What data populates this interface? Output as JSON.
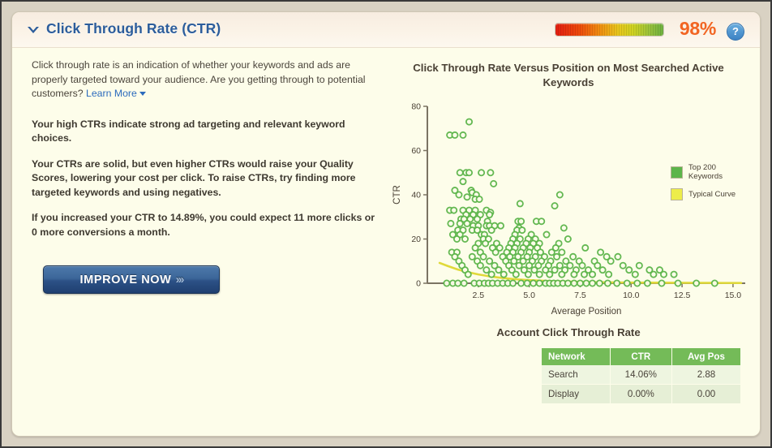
{
  "header": {
    "title": "Click Through Rate (CTR)",
    "collapse_icon": "chevron-down-icon",
    "score": "98%",
    "help_icon": "?",
    "gauge_colors": [
      "#e31d10",
      "#f08a10",
      "#e8c61c",
      "#6db13f"
    ],
    "score_color": "#f26522",
    "title_color": "#2c5d9b"
  },
  "left": {
    "intro": "Click through rate is an indication of whether your keywords and ads are properly targeted toward your audience. Are you getting through to potential customers? ",
    "learn_more": "Learn More",
    "verdict": "Your high CTRs indicate strong ad targeting and relevant keyword choices.",
    "advice": "Your CTRs are solid, but even higher CTRs would raise your Quality Scores, lowering your cost per click. To raise CTRs, try finding more targeted keywords and using negatives.",
    "projection": "If you increased your CTR to 14.89%, you could expect 11 more clicks or 0 more conversions a month.",
    "cta_label": "IMPROVE NOW",
    "cta_arrows": "›››"
  },
  "chart_data": {
    "type": "scatter",
    "title": "Click Through Rate Versus Position on Most Searched Active Keywords",
    "xlabel": "Average Position",
    "ylabel": "CTR",
    "xlim": [
      0,
      15.6
    ],
    "ylim": [
      0,
      80
    ],
    "xticks": [
      2.5,
      5.0,
      7.5,
      10.0,
      12.5,
      15.0
    ],
    "xtick_labels": [
      "2.5",
      "5.0",
      "7.5",
      "10.0",
      "12.5",
      "15.0"
    ],
    "yticks": [
      0,
      20,
      40,
      60,
      80
    ],
    "ytick_labels": [
      "0",
      "20",
      "40",
      "60",
      "80"
    ],
    "grid": false,
    "legend_position": "right",
    "series": [
      {
        "name": "Top 200 Keywords",
        "color": "#5cb54a",
        "marker": "open-circle",
        "points": [
          [
            1.1,
            67
          ],
          [
            1.35,
            67
          ],
          [
            1.75,
            67
          ],
          [
            2.05,
            73
          ],
          [
            1.6,
            50
          ],
          [
            1.9,
            50
          ],
          [
            2.05,
            50
          ],
          [
            2.65,
            50
          ],
          [
            3.1,
            50
          ],
          [
            1.75,
            46
          ],
          [
            3.25,
            45
          ],
          [
            1.35,
            42
          ],
          [
            2.15,
            42
          ],
          [
            2.2,
            41
          ],
          [
            1.55,
            40
          ],
          [
            2.4,
            40
          ],
          [
            6.5,
            40
          ],
          [
            1.95,
            39
          ],
          [
            2.35,
            38
          ],
          [
            2.55,
            38
          ],
          [
            4.55,
            36
          ],
          [
            6.25,
            35
          ],
          [
            1.1,
            33
          ],
          [
            1.3,
            33
          ],
          [
            1.75,
            33
          ],
          [
            2.05,
            33
          ],
          [
            2.35,
            33
          ],
          [
            2.9,
            33
          ],
          [
            3.1,
            32
          ],
          [
            1.9,
            31
          ],
          [
            2.25,
            31
          ],
          [
            2.6,
            31
          ],
          [
            3.05,
            31
          ],
          [
            1.65,
            29
          ],
          [
            1.8,
            29
          ],
          [
            2.1,
            29
          ],
          [
            2.45,
            29
          ],
          [
            2.95,
            28
          ],
          [
            4.45,
            28
          ],
          [
            4.6,
            28
          ],
          [
            5.35,
            28
          ],
          [
            5.6,
            28
          ],
          [
            1.15,
            27
          ],
          [
            1.6,
            27
          ],
          [
            1.95,
            27
          ],
          [
            2.25,
            26
          ],
          [
            2.5,
            26
          ],
          [
            2.9,
            26
          ],
          [
            3.05,
            26
          ],
          [
            3.3,
            26
          ],
          [
            3.6,
            26
          ],
          [
            4.5,
            25
          ],
          [
            6.7,
            25
          ],
          [
            1.5,
            24
          ],
          [
            1.75,
            24
          ],
          [
            2.2,
            24
          ],
          [
            2.45,
            24
          ],
          [
            3.15,
            24
          ],
          [
            4.4,
            24
          ],
          [
            4.65,
            24
          ],
          [
            1.25,
            22
          ],
          [
            1.6,
            22
          ],
          [
            2.65,
            22
          ],
          [
            2.8,
            22
          ],
          [
            4.3,
            22
          ],
          [
            5.1,
            22
          ],
          [
            5.85,
            22
          ],
          [
            1.45,
            20
          ],
          [
            1.85,
            20
          ],
          [
            2.75,
            20
          ],
          [
            3.0,
            20
          ],
          [
            4.2,
            20
          ],
          [
            4.55,
            20
          ],
          [
            4.95,
            20
          ],
          [
            5.3,
            20
          ],
          [
            6.9,
            20
          ],
          [
            2.5,
            18
          ],
          [
            2.85,
            18
          ],
          [
            3.4,
            18
          ],
          [
            4.1,
            18
          ],
          [
            4.4,
            18
          ],
          [
            4.85,
            18
          ],
          [
            5.2,
            18
          ],
          [
            5.5,
            18
          ],
          [
            6.45,
            18
          ],
          [
            2.35,
            16
          ],
          [
            3.2,
            16
          ],
          [
            3.55,
            16
          ],
          [
            4.0,
            16
          ],
          [
            4.3,
            16
          ],
          [
            4.7,
            16
          ],
          [
            5.05,
            16
          ],
          [
            5.4,
            16
          ],
          [
            6.3,
            16
          ],
          [
            7.75,
            16
          ],
          [
            1.2,
            14
          ],
          [
            1.45,
            14
          ],
          [
            2.6,
            14
          ],
          [
            3.35,
            14
          ],
          [
            3.9,
            14
          ],
          [
            4.2,
            14
          ],
          [
            4.6,
            14
          ],
          [
            5.0,
            14
          ],
          [
            5.55,
            14
          ],
          [
            6.1,
            14
          ],
          [
            6.6,
            14
          ],
          [
            8.5,
            14
          ],
          [
            1.35,
            12
          ],
          [
            2.2,
            12
          ],
          [
            2.75,
            12
          ],
          [
            3.7,
            12
          ],
          [
            4.05,
            12
          ],
          [
            4.45,
            12
          ],
          [
            4.9,
            12
          ],
          [
            5.3,
            12
          ],
          [
            5.75,
            12
          ],
          [
            6.35,
            12
          ],
          [
            7.15,
            12
          ],
          [
            8.8,
            12
          ],
          [
            9.35,
            12
          ],
          [
            1.55,
            10
          ],
          [
            2.45,
            10
          ],
          [
            3.05,
            10
          ],
          [
            3.85,
            10
          ],
          [
            4.25,
            10
          ],
          [
            4.7,
            10
          ],
          [
            5.15,
            10
          ],
          [
            5.6,
            10
          ],
          [
            6.05,
            10
          ],
          [
            6.8,
            10
          ],
          [
            7.45,
            10
          ],
          [
            8.2,
            10
          ],
          [
            9.0,
            10
          ],
          [
            1.7,
            8
          ],
          [
            2.6,
            8
          ],
          [
            3.3,
            8
          ],
          [
            4.0,
            8
          ],
          [
            4.5,
            8
          ],
          [
            5.0,
            8
          ],
          [
            5.45,
            8
          ],
          [
            5.95,
            8
          ],
          [
            6.5,
            8
          ],
          [
            7.0,
            8
          ],
          [
            7.6,
            8
          ],
          [
            8.35,
            8
          ],
          [
            9.6,
            8
          ],
          [
            10.4,
            8
          ],
          [
            1.85,
            6
          ],
          [
            2.9,
            6
          ],
          [
            3.5,
            6
          ],
          [
            4.15,
            6
          ],
          [
            4.75,
            6
          ],
          [
            5.25,
            6
          ],
          [
            5.8,
            6
          ],
          [
            6.25,
            6
          ],
          [
            6.75,
            6
          ],
          [
            7.3,
            6
          ],
          [
            7.9,
            6
          ],
          [
            8.6,
            6
          ],
          [
            9.9,
            6
          ],
          [
            10.9,
            6
          ],
          [
            11.4,
            6
          ],
          [
            2.0,
            4
          ],
          [
            3.15,
            4
          ],
          [
            3.75,
            4
          ],
          [
            4.35,
            4
          ],
          [
            4.95,
            4
          ],
          [
            5.5,
            4
          ],
          [
            6.0,
            4
          ],
          [
            6.6,
            4
          ],
          [
            7.2,
            4
          ],
          [
            7.7,
            4
          ],
          [
            8.1,
            4
          ],
          [
            8.9,
            4
          ],
          [
            10.2,
            4
          ],
          [
            11.1,
            4
          ],
          [
            11.6,
            4
          ],
          [
            12.1,
            4
          ],
          [
            0.95,
            0
          ],
          [
            1.25,
            0
          ],
          [
            1.5,
            0
          ],
          [
            1.8,
            0
          ],
          [
            2.3,
            0
          ],
          [
            2.55,
            0
          ],
          [
            2.8,
            0
          ],
          [
            3.0,
            0
          ],
          [
            3.2,
            0
          ],
          [
            3.45,
            0
          ],
          [
            3.7,
            0
          ],
          [
            3.95,
            0
          ],
          [
            4.2,
            0
          ],
          [
            4.6,
            0
          ],
          [
            4.9,
            0
          ],
          [
            5.2,
            0
          ],
          [
            5.5,
            0
          ],
          [
            5.8,
            0
          ],
          [
            6.0,
            0
          ],
          [
            6.2,
            0
          ],
          [
            6.4,
            0
          ],
          [
            6.65,
            0
          ],
          [
            6.9,
            0
          ],
          [
            7.2,
            0
          ],
          [
            7.5,
            0
          ],
          [
            7.8,
            0
          ],
          [
            8.1,
            0
          ],
          [
            8.45,
            0
          ],
          [
            8.85,
            0
          ],
          [
            9.3,
            0
          ],
          [
            9.8,
            0
          ],
          [
            10.3,
            0
          ],
          [
            10.8,
            0
          ],
          [
            11.5,
            0
          ],
          [
            12.3,
            0
          ],
          [
            13.2,
            0
          ],
          [
            14.1,
            0
          ]
        ]
      }
    ],
    "curve": {
      "name": "Typical Curve",
      "color": "#e0d93a",
      "points": [
        [
          0.6,
          9.2
        ],
        [
          1.0,
          7.8
        ],
        [
          1.5,
          6.2
        ],
        [
          2.0,
          5.0
        ],
        [
          2.5,
          4.0
        ],
        [
          3.0,
          3.2
        ],
        [
          3.5,
          2.6
        ],
        [
          4.0,
          2.1
        ],
        [
          4.5,
          1.7
        ],
        [
          5.0,
          1.4
        ],
        [
          6.0,
          1.0
        ],
        [
          7.0,
          0.7
        ],
        [
          8.0,
          0.5
        ],
        [
          9.0,
          0.4
        ],
        [
          10.0,
          0.3
        ],
        [
          11.0,
          0.25
        ],
        [
          12.0,
          0.2
        ],
        [
          13.0,
          0.18
        ],
        [
          14.0,
          0.15
        ],
        [
          15.4,
          0.12
        ]
      ]
    }
  },
  "table": {
    "title": "Account Click Through Rate",
    "columns": [
      "Network",
      "CTR",
      "Avg Pos"
    ],
    "header_color": "#74bb58",
    "rows": [
      {
        "network": "Search",
        "ctr": "14.06%",
        "avg_pos": "2.88"
      },
      {
        "network": "Display",
        "ctr": "0.00%",
        "avg_pos": "0.00"
      }
    ]
  }
}
